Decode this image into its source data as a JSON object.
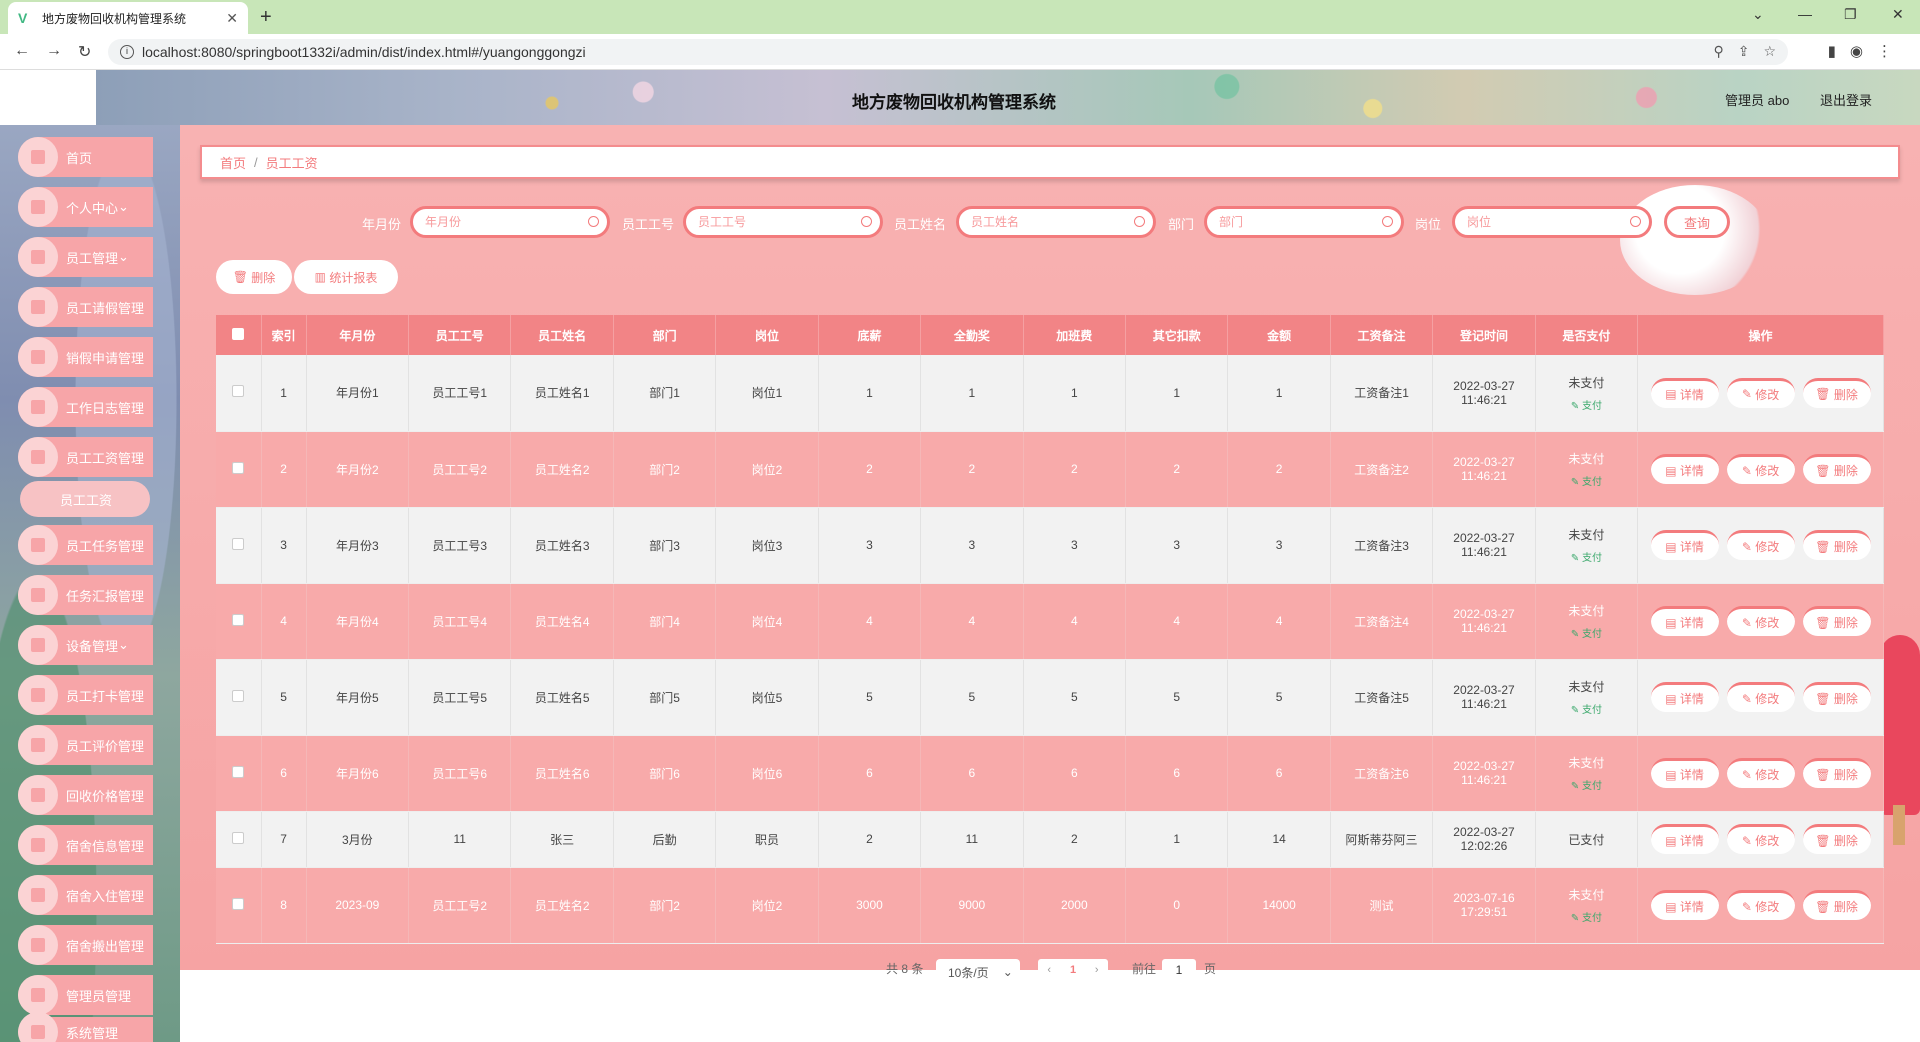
{
  "browser": {
    "tab_title": "地方废物回收机构管理系统",
    "url": "localhost:8080/springboot1332i/admin/dist/index.html#/yuangonggongzi"
  },
  "header": {
    "title": "地方废物回收机构管理系统",
    "admin": "管理员 abo",
    "logout": "退出登录"
  },
  "sidebar": {
    "items": [
      {
        "label": "首页"
      },
      {
        "label": "个人中心"
      },
      {
        "label": "员工管理"
      },
      {
        "label": "员工请假管理"
      },
      {
        "label": "销假申请管理"
      },
      {
        "label": "工作日志管理"
      },
      {
        "label": "员工工资管理"
      },
      {
        "label": "员工任务管理"
      },
      {
        "label": "任务汇报管理"
      },
      {
        "label": "设备管理"
      },
      {
        "label": "员工打卡管理"
      },
      {
        "label": "员工评价管理"
      },
      {
        "label": "回收价格管理"
      },
      {
        "label": "宿舍信息管理"
      },
      {
        "label": "宿舍入住管理"
      },
      {
        "label": "宿舍搬出管理"
      },
      {
        "label": "管理员管理"
      },
      {
        "label": "系统管理"
      }
    ],
    "sub_active": "员工工资"
  },
  "breadcrumb": {
    "home": "首页",
    "current": "员工工资"
  },
  "search": {
    "fields": [
      {
        "label": "年月份",
        "placeholder": "年月份"
      },
      {
        "label": "员工工号",
        "placeholder": "员工工号"
      },
      {
        "label": "员工姓名",
        "placeholder": "员工姓名"
      },
      {
        "label": "部门",
        "placeholder": "部门"
      },
      {
        "label": "岗位",
        "placeholder": "岗位"
      }
    ],
    "query": "查询"
  },
  "actions": {
    "delete": "删除",
    "report": "统计报表"
  },
  "table": {
    "headers": [
      "索引",
      "年月份",
      "员工工号",
      "员工姓名",
      "部门",
      "岗位",
      "底薪",
      "全勤奖",
      "加班费",
      "其它扣款",
      "金额",
      "工资备注",
      "登记时间",
      "是否支付",
      "操作"
    ],
    "rows": [
      {
        "idx": "1",
        "ym": "年月份1",
        "no": "员工工号1",
        "name": "员工姓名1",
        "dept": "部门1",
        "post": "岗位1",
        "base": "1",
        "full": "1",
        "ot": "1",
        "ded": "1",
        "amt": "1",
        "note": "工资备注1",
        "date": "2022-03-27",
        "time": "11:46:21",
        "paid": "未支付",
        "pay": "支付"
      },
      {
        "idx": "2",
        "ym": "年月份2",
        "no": "员工工号2",
        "name": "员工姓名2",
        "dept": "部门2",
        "post": "岗位2",
        "base": "2",
        "full": "2",
        "ot": "2",
        "ded": "2",
        "amt": "2",
        "note": "工资备注2",
        "date": "2022-03-27",
        "time": "11:46:21",
        "paid": "未支付",
        "pay": "支付"
      },
      {
        "idx": "3",
        "ym": "年月份3",
        "no": "员工工号3",
        "name": "员工姓名3",
        "dept": "部门3",
        "post": "岗位3",
        "base": "3",
        "full": "3",
        "ot": "3",
        "ded": "3",
        "amt": "3",
        "note": "工资备注3",
        "date": "2022-03-27",
        "time": "11:46:21",
        "paid": "未支付",
        "pay": "支付"
      },
      {
        "idx": "4",
        "ym": "年月份4",
        "no": "员工工号4",
        "name": "员工姓名4",
        "dept": "部门4",
        "post": "岗位4",
        "base": "4",
        "full": "4",
        "ot": "4",
        "ded": "4",
        "amt": "4",
        "note": "工资备注4",
        "date": "2022-03-27",
        "time": "11:46:21",
        "paid": "未支付",
        "pay": "支付"
      },
      {
        "idx": "5",
        "ym": "年月份5",
        "no": "员工工号5",
        "name": "员工姓名5",
        "dept": "部门5",
        "post": "岗位5",
        "base": "5",
        "full": "5",
        "ot": "5",
        "ded": "5",
        "amt": "5",
        "note": "工资备注5",
        "date": "2022-03-27",
        "time": "11:46:21",
        "paid": "未支付",
        "pay": "支付"
      },
      {
        "idx": "6",
        "ym": "年月份6",
        "no": "员工工号6",
        "name": "员工姓名6",
        "dept": "部门6",
        "post": "岗位6",
        "base": "6",
        "full": "6",
        "ot": "6",
        "ded": "6",
        "amt": "6",
        "note": "工资备注6",
        "date": "2022-03-27",
        "time": "11:46:21",
        "paid": "未支付",
        "pay": "支付"
      },
      {
        "idx": "7",
        "ym": "3月份",
        "no": "11",
        "name": "张三",
        "dept": "后勤",
        "post": "职员",
        "base": "2",
        "full": "11",
        "ot": "2",
        "ded": "1",
        "amt": "14",
        "note": "阿斯蒂芬阿三",
        "date": "2022-03-27",
        "time": "12:02:26",
        "paid": "已支付",
        "pay": ""
      },
      {
        "idx": "8",
        "ym": "2023-09",
        "no": "员工工号2",
        "name": "员工姓名2",
        "dept": "部门2",
        "post": "岗位2",
        "base": "3000",
        "full": "9000",
        "ot": "2000",
        "ded": "0",
        "amt": "14000",
        "note": "测试",
        "date": "2023-07-16",
        "time": "17:29:51",
        "paid": "未支付",
        "pay": "支付"
      }
    ],
    "op_detail": "详情",
    "op_edit": "修改",
    "op_delete": "删除"
  },
  "pagination": {
    "total": "共 8 条",
    "page_size": "10条/页",
    "current": "1",
    "goto_label": "前往",
    "goto_value": "1",
    "page_unit": "页"
  },
  "colors": {
    "accent": "#f37b7d",
    "header_bg": "#f28486",
    "row_alt": "#f8aaaa"
  }
}
